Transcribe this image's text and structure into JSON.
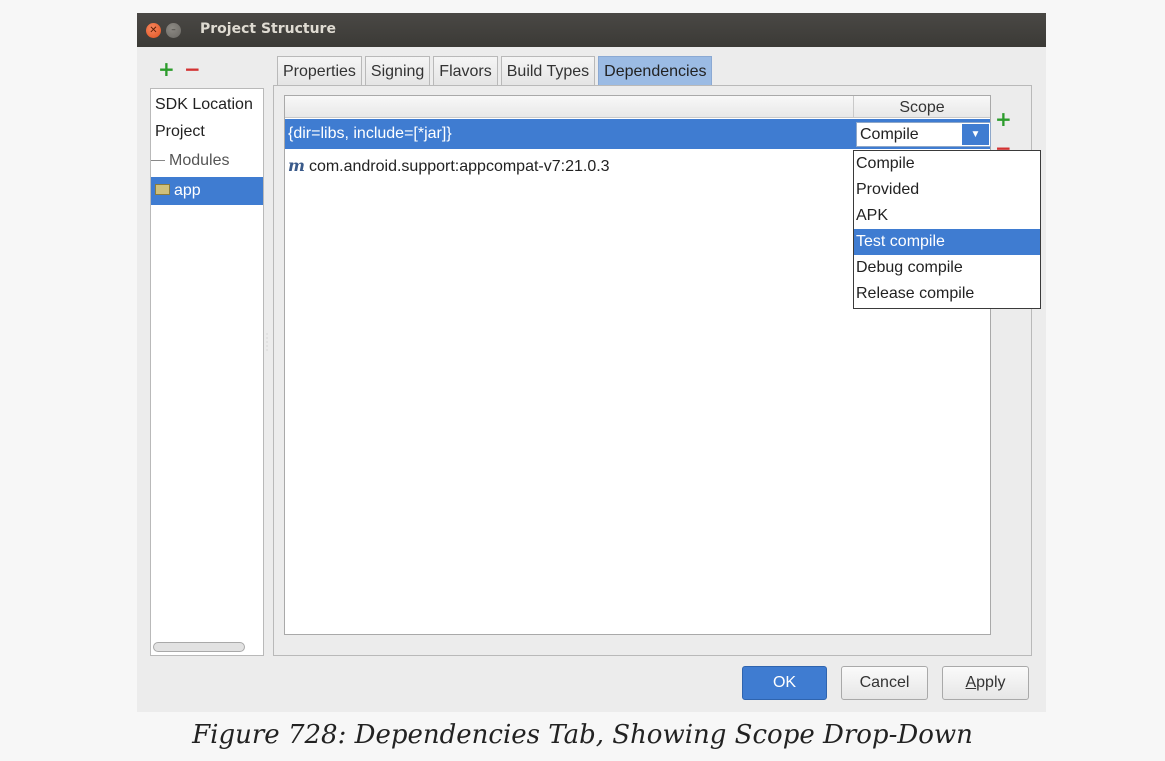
{
  "window": {
    "title": "Project Structure",
    "close_glyph": "✕",
    "minimize_glyph": "–"
  },
  "sidebar": {
    "add_glyph": "+",
    "remove_glyph": "−",
    "items": [
      {
        "label": "SDK Location"
      },
      {
        "label": "Project"
      },
      {
        "label": "Modules"
      },
      {
        "label": "app"
      }
    ],
    "selected": "app"
  },
  "tabs": [
    {
      "label": "Properties"
    },
    {
      "label": "Signing"
    },
    {
      "label": "Flavors"
    },
    {
      "label": "Build Types"
    },
    {
      "label": "Dependencies"
    }
  ],
  "active_tab": "Dependencies",
  "dependencies": {
    "scope_header": "Scope",
    "add_glyph": "+",
    "remove_glyph": "−",
    "rows": [
      {
        "name": "{dir=libs, include=[*jar]}",
        "scope": "Compile"
      },
      {
        "icon": "m",
        "name": "com.android.support:appcompat-v7:21.0.3"
      }
    ],
    "combo_arrow_glyph": "▼"
  },
  "scope_dropdown": {
    "options": [
      "Compile",
      "Provided",
      "APK",
      "Test compile",
      "Debug compile",
      "Release compile"
    ],
    "highlighted": "Test compile"
  },
  "buttons": {
    "ok": "OK",
    "cancel": "Cancel",
    "apply_mnemonic": "A",
    "apply_rest": "pply"
  },
  "caption": "Figure 728: Dependencies Tab, Showing Scope Drop-Down",
  "colors": {
    "selection": "#3f7cd1",
    "titlebar": "#3b3a36",
    "add": "#2c9c2c",
    "remove": "#d33232"
  }
}
